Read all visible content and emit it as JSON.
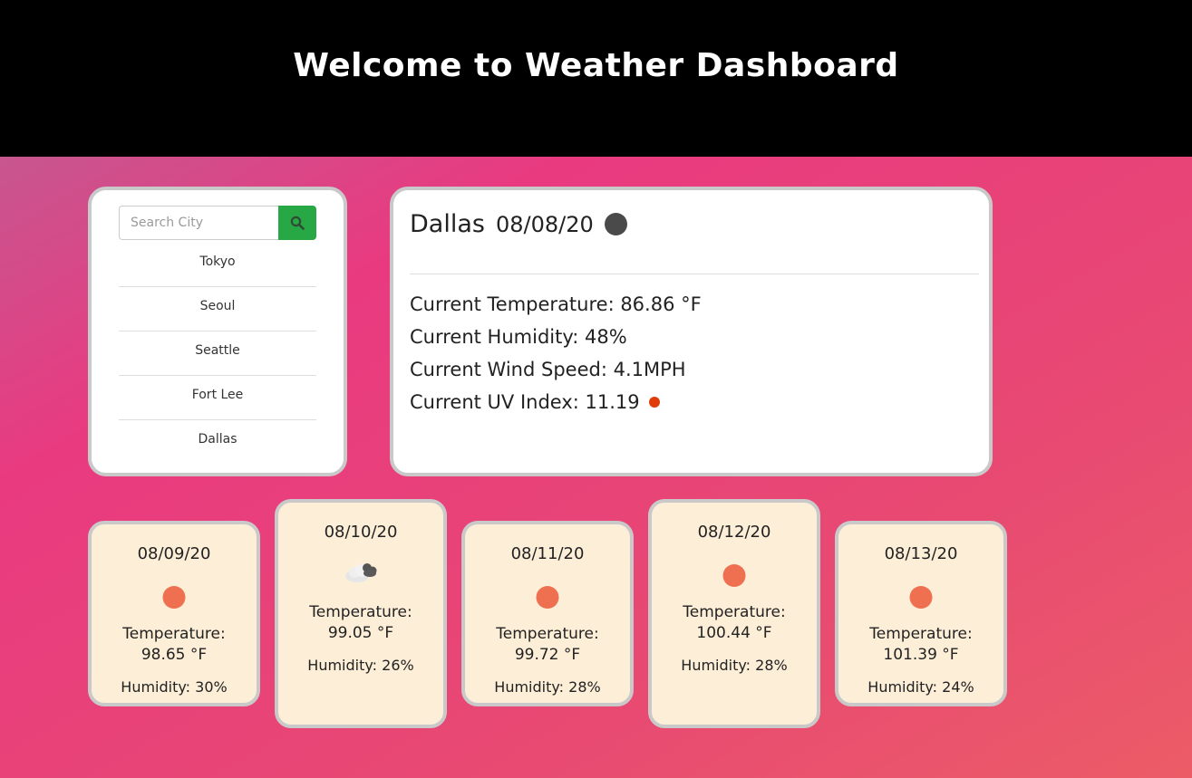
{
  "header": {
    "title": "Welcome to Weather Dashboard"
  },
  "search": {
    "placeholder": "Search City",
    "button_icon": "search-icon",
    "button_color": "#28a745"
  },
  "history": [
    "Tokyo",
    "Seoul",
    "Seattle",
    "Fort Lee",
    "Dallas"
  ],
  "current": {
    "city": "Dallas",
    "date": "08/08/20",
    "icon": "moon-icon",
    "temperature": "Current Temperature: 86.86 °F",
    "humidity": "Current Humidity: 48%",
    "wind": "Current Wind Speed: 4.1MPH",
    "uv": "Current UV Index: 11.19",
    "uv_color": "#e03c0a"
  },
  "forecast": [
    {
      "date": "08/09/20",
      "icon": "sun-icon",
      "temperature": "Temperature: 98.65 °F",
      "humidity": "Humidity: 30%"
    },
    {
      "date": "08/10/20",
      "icon": "cloud-icon",
      "temperature": "Temperature: 99.05 °F",
      "humidity": "Humidity: 26%"
    },
    {
      "date": "08/11/20",
      "icon": "sun-icon",
      "temperature": "Temperature: 99.72 °F",
      "humidity": "Humidity: 28%"
    },
    {
      "date": "08/12/20",
      "icon": "sun-icon",
      "temperature": "Temperature: 100.44 °F",
      "humidity": "Humidity: 28%"
    },
    {
      "date": "08/13/20",
      "icon": "sun-icon",
      "temperature": "Temperature: 101.39 °F",
      "humidity": "Humidity: 24%"
    }
  ]
}
